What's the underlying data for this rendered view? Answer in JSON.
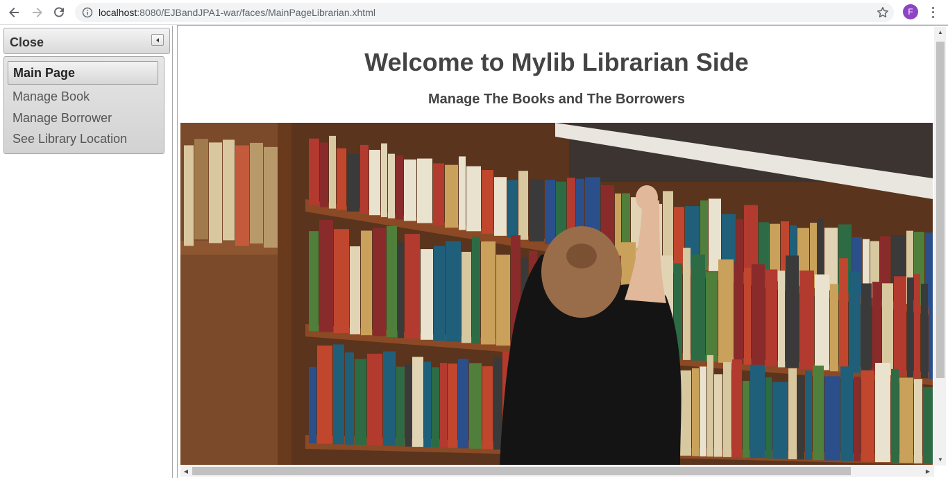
{
  "browser": {
    "url_host": "localhost",
    "url_path": ":8080/EJBandJPA1-war/faces/MainPageLibrarian.xhtml",
    "profile_initial": "F",
    "profile_color": "#8e44c4"
  },
  "sidebar": {
    "header_title": "Close",
    "items": [
      {
        "label": "Main Page",
        "active": true
      },
      {
        "label": "Manage Book",
        "active": false
      },
      {
        "label": "Manage Borrower",
        "active": false
      },
      {
        "label": "See Library Location",
        "active": false
      }
    ]
  },
  "main": {
    "title": "Welcome to Mylib Librarian Side",
    "subtitle": "Manage The Books and The Borrowers"
  },
  "icons": {
    "back": "arrow-left-icon",
    "forward": "arrow-right-icon",
    "reload": "reload-icon",
    "info": "info-icon",
    "bookmark": "star-icon",
    "menu": "kebab-menu-icon",
    "collapse": "triangle-left-icon"
  }
}
